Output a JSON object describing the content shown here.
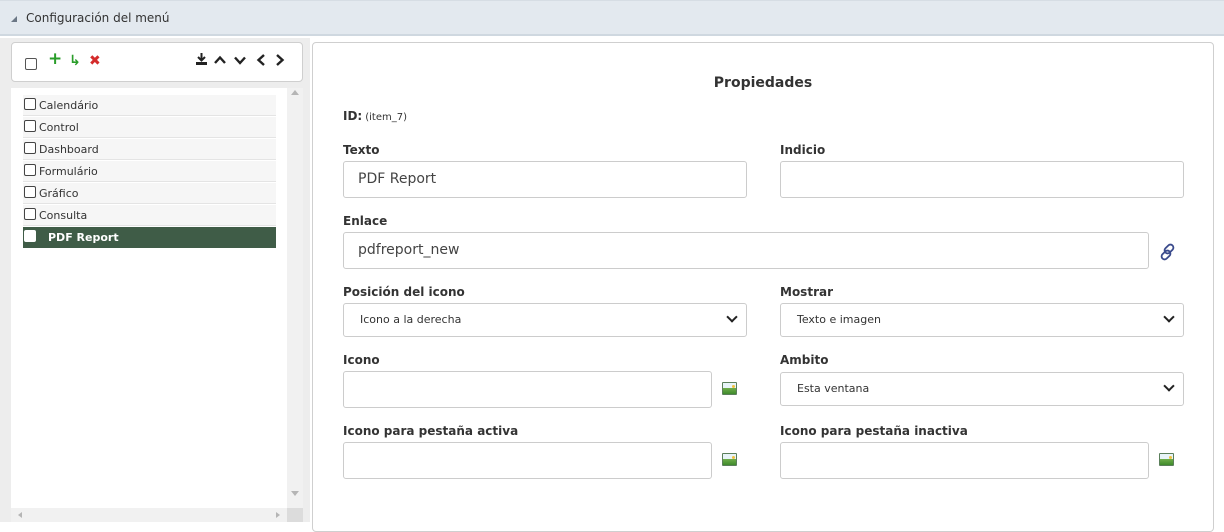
{
  "header": {
    "title": "Configuración del menú"
  },
  "toolbar": {
    "icons": [
      "select-all-checkbox",
      "add-icon",
      "add-subitem-icon",
      "delete-icon",
      "download-icon",
      "move-up-icon",
      "move-down-icon",
      "move-left-icon",
      "move-right-icon"
    ],
    "colors": {
      "add": "#2a9d2a",
      "delete": "#d42b2b",
      "nav": "#222222"
    }
  },
  "tree": {
    "items": [
      {
        "label": "Calendário"
      },
      {
        "label": "Control"
      },
      {
        "label": "Dashboard"
      },
      {
        "label": "Formulário"
      },
      {
        "label": "Gráfico"
      },
      {
        "label": "Consulta"
      },
      {
        "label": "PDF Report",
        "selected": true
      }
    ],
    "selected_color": "#3f5c47"
  },
  "properties": {
    "title": "Propiedades",
    "id_label": "ID:",
    "id_value": "(item_7)",
    "texto": {
      "label": "Texto",
      "value": "PDF Report"
    },
    "indicio": {
      "label": "Indicio",
      "value": ""
    },
    "enlace": {
      "label": "Enlace",
      "value": "pdfreport_new"
    },
    "posicion_icono": {
      "label": "Posición del icono",
      "value": "Icono a la derecha"
    },
    "mostrar": {
      "label": "Mostrar",
      "value": "Texto e imagen"
    },
    "icono": {
      "label": "Icono",
      "value": ""
    },
    "ambito": {
      "label": "Ambito",
      "value": "Esta ventana"
    },
    "icono_activa": {
      "label": "Icono para pestaña activa",
      "value": ""
    },
    "icono_inactiva": {
      "label": "Icono para pestaña inactiva",
      "value": ""
    }
  }
}
